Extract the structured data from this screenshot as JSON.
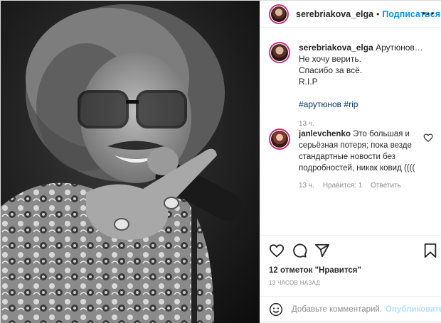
{
  "post": {
    "username": "serebriakova_elga",
    "separator": "•",
    "follow_label": "Подписаться",
    "more_icon": "more-horizontal-icon"
  },
  "caption": {
    "username": "serebriakova_elga",
    "first_line": "Арутюнов…",
    "lines": [
      "Не хочу верить.",
      "Спасибо за всё.",
      "R.I.P"
    ],
    "hashtags": [
      "#арутюнов",
      "#rip"
    ],
    "time": "13 ч."
  },
  "comment": {
    "username": "janlevchenko",
    "text": "Это большая и серьёзная потеря; пока везде стандартные новости без подробностей, никак ковид ((((",
    "time": "13 ч.",
    "likes": "Нравится: 1",
    "reply": "Ответить"
  },
  "actions": {
    "icons": [
      "heart-icon",
      "comment-icon",
      "share-icon",
      "bookmark-icon"
    ]
  },
  "likes_text": "12 отметок \"Нравится\"",
  "posted_ago": "13 ЧАСОВ НАЗАД",
  "add_comment": {
    "placeholder": "Добавьте комментарий...",
    "publish_label": "Опубликовать"
  },
  "colors": {
    "accent": "#0095f6",
    "publish_disabled": "#b2dffc",
    "hashtag": "#00376b",
    "muted": "#8e8e8e"
  }
}
